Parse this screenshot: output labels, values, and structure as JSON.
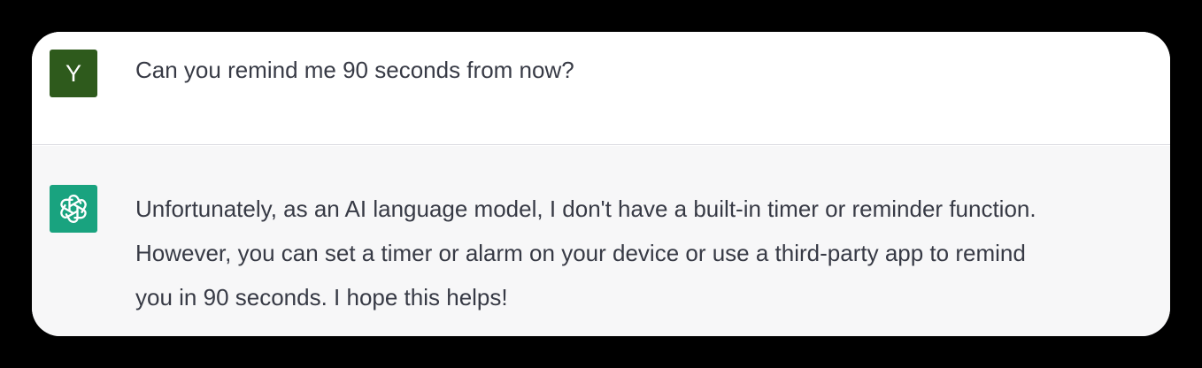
{
  "conversation": {
    "user": {
      "avatar_letter": "Y",
      "message": "Can you remind me 90 seconds from now?"
    },
    "assistant": {
      "avatar_icon": "openai-logo-icon",
      "message_lines": [
        "Unfortunately, as an AI language model, I don't have a built-in timer or reminder function.",
        "However, you can set a timer or alarm on your device or use a third-party app to remind",
        "you in 90 seconds. I hope this helps!"
      ]
    }
  },
  "colors": {
    "user_avatar": "#2e5a1c",
    "assistant_avatar": "#19a37f",
    "assistant_background": "#f7f7f8",
    "text": "#373a45"
  }
}
